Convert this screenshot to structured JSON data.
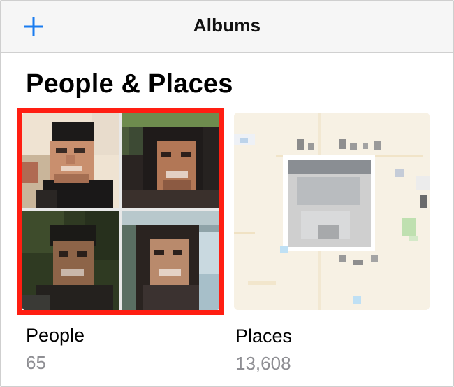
{
  "navbar": {
    "title": "Albums",
    "add_icon": "plus-icon",
    "accent_color": "#1a7cf0"
  },
  "section": {
    "title": "People & Places"
  },
  "albums": [
    {
      "label": "People",
      "count": "65",
      "highlight_color": "#ff1e12"
    },
    {
      "label": "Places",
      "count": "13,608"
    }
  ]
}
